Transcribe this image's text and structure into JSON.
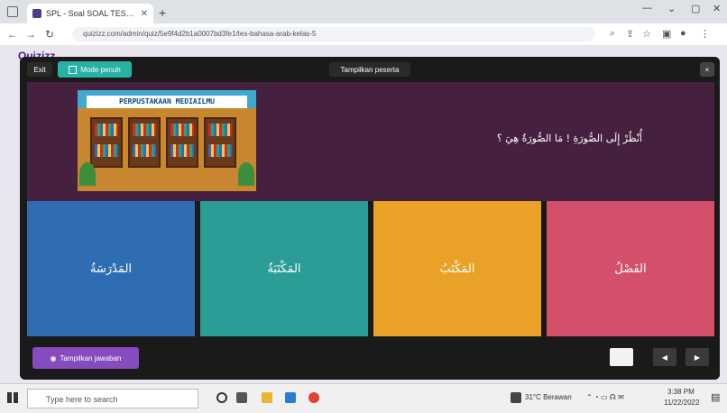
{
  "browser": {
    "tab_title": "SPL - Soal SOAL TEST Bahasa",
    "url": "quizizz.com/admin/quiz/5e9f4d2b1a0007bd3fe1/tes-bahasa-arab-kelas-5",
    "colors": {
      "tab_bg": "#dee1e6"
    }
  },
  "page": {
    "logo": "Quizizz"
  },
  "modal": {
    "exit_label": "Exit",
    "fullscreen_label": "Mode penuh",
    "show_participants_label": "Tampilkan peserta",
    "close_label": "×",
    "question": {
      "image_sign": "PERPUSTAKAAN MEDIAILMU",
      "text": "أُنْظُرْ إِلَى الصُّورَةِ ! مَا الصُّورَةُ هِيَ ؟"
    },
    "answers": [
      {
        "text": "المَدْرَسَةُ",
        "color": "#2f6db3"
      },
      {
        "text": "المَكْتَبَةُ",
        "color": "#2a9d97"
      },
      {
        "text": "المَكْتَبُ",
        "color": "#e9a227"
      },
      {
        "text": "الفَصْلُ",
        "color": "#d4506a"
      }
    ],
    "show_answer_label": "Tampilkan jawaban"
  },
  "taskbar": {
    "search_placeholder": "Type here to search",
    "weather": "31°C Berawan",
    "time": "3:38 PM",
    "date": "11/22/2022"
  }
}
